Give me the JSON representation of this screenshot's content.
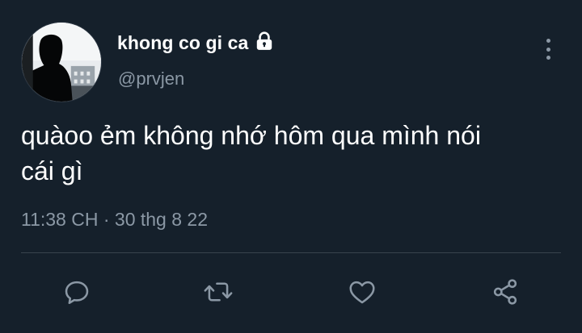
{
  "user": {
    "display_name": "khong co gi ca",
    "handle": "@prvjen"
  },
  "tweet": {
    "text": "quàoo ẻm không nhớ hôm qua mình nói\ncái gì",
    "timestamp": "11:38 CH · 30 thg 8 22"
  },
  "icons": {
    "lock": "lock-icon",
    "more": "vertical-ellipsis-icon",
    "reply": "reply-icon",
    "retweet": "retweet-icon",
    "like": "heart-icon",
    "share": "share-icon"
  },
  "colors": {
    "background": "#15202b",
    "primary_text": "#ffffff",
    "secondary_text": "#8b98a5",
    "divider": "#38444d"
  }
}
